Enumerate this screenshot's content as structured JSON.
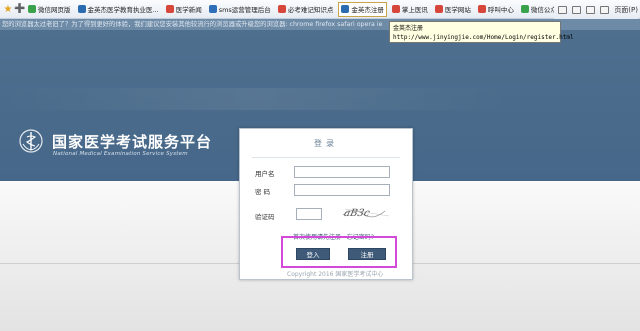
{
  "favorites": {
    "items": [
      {
        "label": "微信网页版",
        "color": "#3aa24a"
      },
      {
        "label": "金英杰医学教育执业医...",
        "color": "#2b6cb0"
      },
      {
        "label": "医学新闻",
        "color": "#d6463b"
      },
      {
        "label": "sms运营管理后台",
        "color": "#2f6fb7"
      },
      {
        "label": "必考难记知识点",
        "color": "#d6463b"
      },
      {
        "label": "金英杰注册",
        "color": "#2b6cb0"
      },
      {
        "label": "掌上医讯",
        "color": "#d6463b"
      },
      {
        "label": "医学网站",
        "color": "#d6463b"
      },
      {
        "label": "呼叫中心",
        "color": "#d6463b"
      },
      {
        "label": "微信公众平台",
        "color": "#3aa24a"
      }
    ],
    "page_menu_label": "页面(P)"
  },
  "tooltip": {
    "title": "金英杰注册",
    "url": "http://www.jinyingjie.com/Home/Login/register.html"
  },
  "warning_text": "您的浏览器太过老旧了？为了得到更好的体验，我们建议您安装其他较流行的浏览器或升级您的浏览器: chrome firefox safari opera ie",
  "brand": {
    "name_cn": "国家医学考试服务平台",
    "name_en": "National Medical Examination Service System"
  },
  "login": {
    "title": "登录",
    "username_label": "用户名",
    "password_label": "密 码",
    "captcha_label": "验证码",
    "username_value": "",
    "password_value": "",
    "captcha_value": "",
    "captcha_text": "aB3c",
    "register_note": "首次使用请先注册 · 忘记密码?",
    "login_button": "登入",
    "register_button": "注册",
    "copyright": "Copyright 2016 国家医学考试中心"
  },
  "colors": {
    "band": "#4a6b8b",
    "button": "#3e5a78",
    "highlight": "#d44ad8"
  }
}
